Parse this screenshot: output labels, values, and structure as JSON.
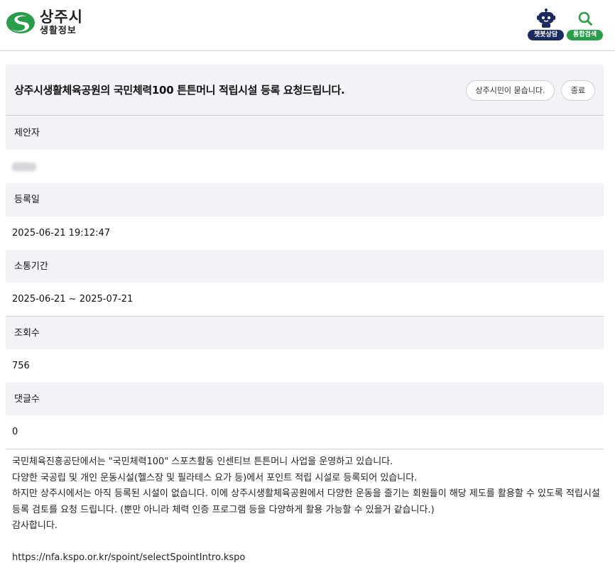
{
  "brand": {
    "title": "상주시",
    "subtitle": "생활정보",
    "colors": {
      "green": "#2a9d4a",
      "navy": "#1c2b5e"
    }
  },
  "header": {
    "chatbot_label": "챗봇상담",
    "chatbot_icon": "robot-icon",
    "search_label": "통합검색",
    "search_icon": "search-icon"
  },
  "post": {
    "title": "상주시생활체육공원의 국민체력100 튼튼머니 적립시설 등록 요청드립니다.",
    "ask_button": "상주시민이 묻습니다.",
    "close_button": "종료"
  },
  "fields": [
    {
      "label": "제안자",
      "value": ""
    },
    {
      "label": "등록일",
      "value": "2025-06-21 19:12:47"
    },
    {
      "label": "소통기간",
      "value": "2025-06-21 ~ 2025-07-21"
    },
    {
      "label": "조회수",
      "value": "756"
    },
    {
      "label": "댓글수",
      "value": "0"
    }
  ],
  "content": {
    "lines": [
      "국민체육진흥공단에서는 \"국민체력100\" 스포츠활동 인센티브 튼튼머니 사업을 운영하고 있습니다.",
      "다양한 국공립 및 개인 운동시설(헬스장 및 필라테스 요가 등)에서 포인트 적립 시설로 등록되어 있습니다.",
      "하지만 상주시에서는 아직 등록된 시설이 없습니다. 이에 상주시생활체육공원에서 다양한 운동을 즐기는 회원들이 해당 제도를 활용할 수 있도록 적립시설 등록 검토를 요청 드립니다. (뿐만 아니라 체력 인증 프로그램 등을 다양하게 활용 가능할 수 있을거 같습니다.)",
      "감사합니다."
    ],
    "link": "https://nfa.kspo.or.kr/spoint/selectSpointIntro.kspo"
  }
}
